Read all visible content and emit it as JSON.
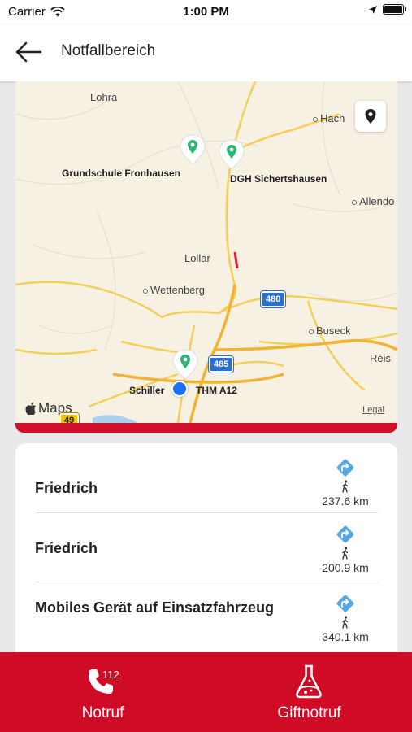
{
  "status_bar": {
    "carrier": "Carrier",
    "time": "1:00 PM"
  },
  "header": {
    "title": "Notfallbereich",
    "back_icon": "arrow-left-icon"
  },
  "map": {
    "labels": {
      "lohra": "Lohra",
      "hach": "Hach",
      "grundschule": "Grundschule Fronhausen",
      "dgh": "DGH Sichertshausen",
      "allendorf": "Allendo",
      "lollar": "Lollar",
      "wettenberg": "Wettenberg",
      "buseck": "Buseck",
      "reis": "Reis",
      "schiller": "Schiller",
      "thm": "THM A12"
    },
    "shields": {
      "a480": "480",
      "a485": "485",
      "a49": "49"
    },
    "maps_logo": "Maps",
    "legal": "Legal",
    "pin_color": "#2bb673"
  },
  "list": {
    "items": [
      {
        "name": "Friedrich",
        "distance": "237.6 km"
      },
      {
        "name": "Friedrich",
        "distance": "200.9 km"
      },
      {
        "name": "Mobiles Gerät auf Einsatzfahrzeug",
        "distance": "340.1 km"
      }
    ]
  },
  "bottom_nav": {
    "notruf_label": "Notruf",
    "notruf_badge": "112",
    "giftnotruf_label": "Giftnotruf",
    "accent": "#cf0b26"
  }
}
